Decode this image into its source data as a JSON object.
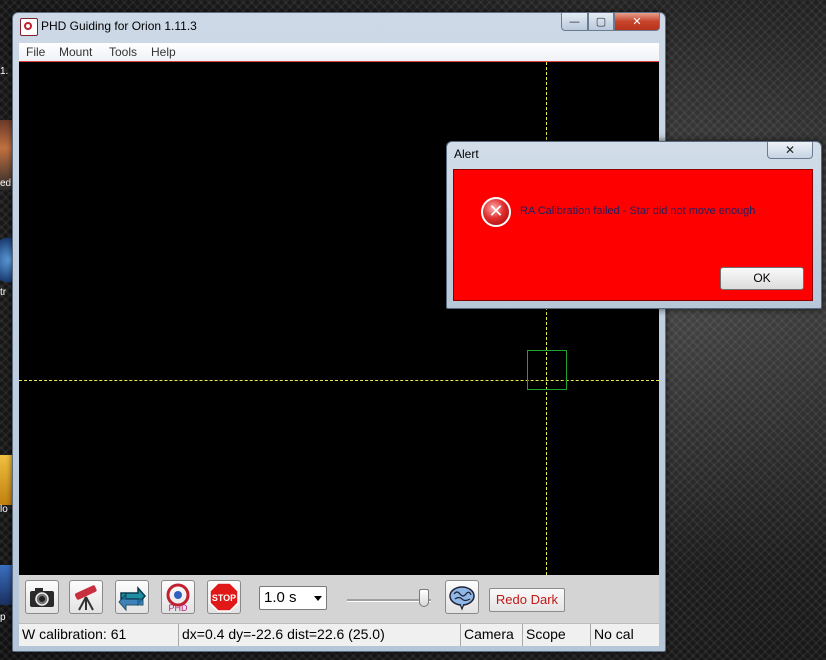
{
  "desktop": {
    "icon_labels": [
      "1.",
      "ed",
      "tr",
      "lo",
      "p"
    ]
  },
  "window": {
    "title": "PHD Guiding for Orion 1.11.3",
    "controls": {
      "minimize": "—",
      "maximize": "▢",
      "close": "✕"
    }
  },
  "menu": {
    "items": [
      {
        "label": "File"
      },
      {
        "label": "Mount"
      },
      {
        "label": "Tools"
      },
      {
        "label": "Help"
      }
    ]
  },
  "toolbar": {
    "buttons": [
      {
        "icon": "camera-icon"
      },
      {
        "icon": "telescope-icon"
      },
      {
        "icon": "loop-icon"
      },
      {
        "icon": "phd-guide-icon"
      },
      {
        "icon": "stop-icon",
        "label": "STOP"
      }
    ],
    "exposure_value": "1.0 s",
    "gain_slider_level": 0.92,
    "brain_icon": "brain-icon",
    "redo_dark_label": "Redo Dark"
  },
  "status": {
    "message": "W calibration: 61",
    "offset": "dx=0.4 dy=-22.6 dist=22.6 (25.0)",
    "camera": "Camera",
    "scope": "Scope",
    "calibration": "No cal"
  },
  "alert": {
    "title": "Alert",
    "close": "✕",
    "icon": "error-icon",
    "message": "RA Calibration failed - Star did not move enough",
    "ok_label": "OK"
  },
  "colors": {
    "alert_background": "#ff0000",
    "crosshair": "#e8e850",
    "star_box": "#1fa32a",
    "redo_dark_text": "#c01818"
  }
}
